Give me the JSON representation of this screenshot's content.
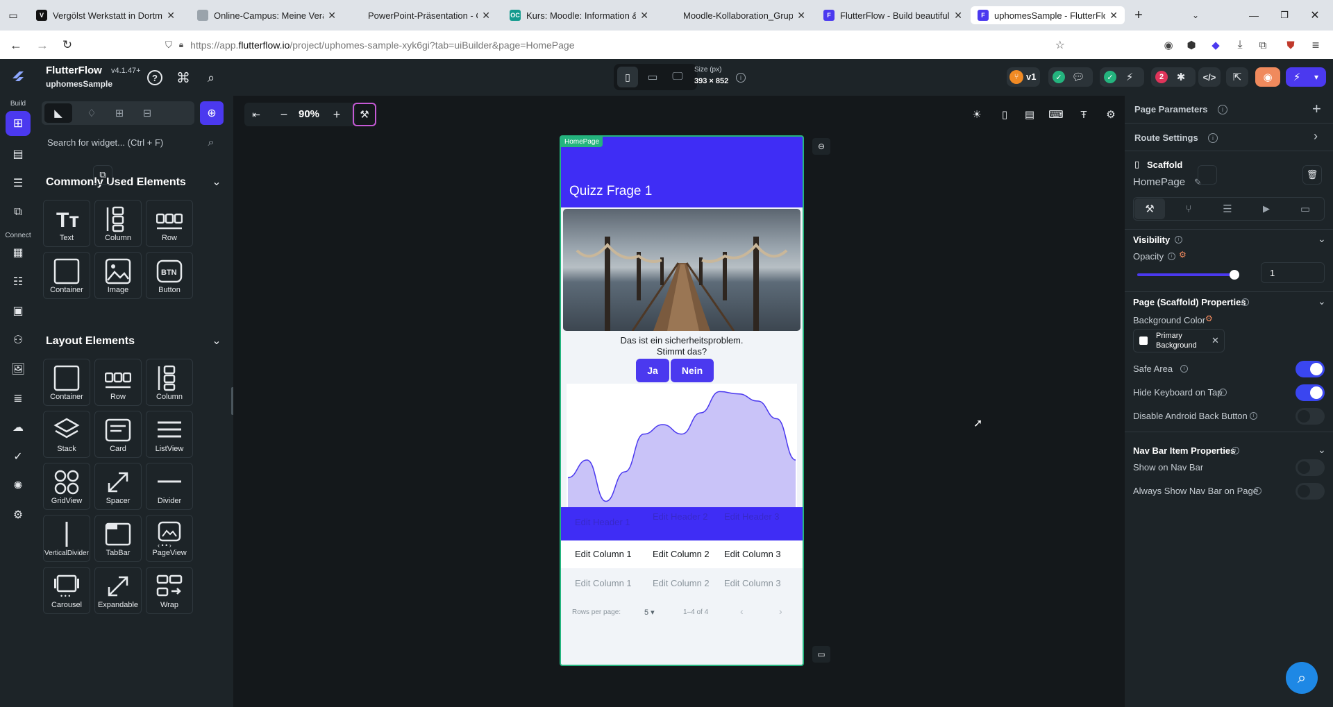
{
  "browser": {
    "tabs": [
      {
        "title": "Vergölst Werkstatt in Dortmund",
        "fav": "V",
        "color": "#111111"
      },
      {
        "title": "Online-Campus: Meine Veranst",
        "fav": "",
        "color": "#9aa3ab"
      },
      {
        "title": "PowerPoint-Präsentation - CoffeeTa",
        "fav": "",
        "color": "#dfe3e8"
      },
      {
        "title": "Kurs: Moodle: Information & Sc",
        "fav": "OC",
        "color": "#139b8e"
      },
      {
        "title": "Moodle-Kollaboration_Gruppen - M",
        "fav": "",
        "color": "#dfe3e8"
      },
      {
        "title": "FlutterFlow - Build beautiful, m",
        "fav": "F",
        "color": "#4b39ef"
      },
      {
        "title": "uphomesSample - FlutterFlow",
        "fav": "F",
        "color": "#4b39ef"
      }
    ],
    "url_prefix": "https://app.",
    "url_host": "flutterflow.io",
    "url_path": "/project/uphomes-sample-xyk6gi?tab=uiBuilder&page=HomePage"
  },
  "header": {
    "brand": "FlutterFlow",
    "version": "v4.1.47+",
    "project": "uphomesSample",
    "size_label": "Size (px)",
    "size_value": "393 × 852",
    "version_badge": "v1",
    "issues_count": "2"
  },
  "rail": {
    "build_label": "Build",
    "connect_label": "Connect"
  },
  "leftpanel": {
    "search_placeholder": "Search for widget... (Ctrl + F)",
    "common_title": "Commonly Used Elements",
    "common": [
      "Text",
      "Column",
      "Row",
      "Container",
      "Image",
      "Button"
    ],
    "layout_title": "Layout Elements",
    "layout": [
      "Container",
      "Row",
      "Column",
      "Stack",
      "Card",
      "ListView",
      "GridView",
      "Spacer",
      "Divider",
      "VerticalDivider",
      "TabBar",
      "PageView",
      "Carousel",
      "Expandable",
      "Wrap"
    ]
  },
  "canvas": {
    "zoom": "90%",
    "page_tag": "HomePage",
    "appbar_title": "Quizz Frage 1",
    "question_line1": "Das ist ein sicherheitsproblem.",
    "question_line2": "Stimmt das?",
    "btn_yes": "Ja",
    "btn_no": "Nein",
    "table_headers": [
      "Edit Header 1",
      "Edit Header 2",
      "Edit Header 3"
    ],
    "table_rows": [
      [
        "Edit Column 1",
        "Edit Column 2",
        "Edit Column 3"
      ],
      [
        "Edit Column 1",
        "Edit Column 2",
        "Edit Column 3"
      ]
    ],
    "rows_per_page_label": "Rows per page:",
    "rows_per_page": "5",
    "range": "1–4 of 4"
  },
  "rightpanel": {
    "page_parameters": "Page Parameters",
    "route_settings": "Route Settings",
    "scaffold": "Scaffold",
    "page_name": "HomePage",
    "visibility": "Visibility",
    "opacity": "Opacity",
    "opacity_value": "1",
    "opacity_level": 1,
    "scaffold_props": "Page (Scaffold) Properties",
    "bg_color_label": "Background Color",
    "bg_color_value_line1": "Primary",
    "bg_color_value_line2": "Background",
    "safe_area": "Safe Area",
    "hide_keyboard": "Hide Keyboard on Tap",
    "disable_back": "Disable Android Back Button",
    "navbar_props": "Nav Bar Item Properties",
    "show_nav": "Show on Nav Bar",
    "always_nav": "Always Show Nav Bar on Page",
    "toggles": {
      "safe_area": true,
      "hide_keyboard": true,
      "disable_back": false,
      "show_nav": false,
      "always_nav": false
    }
  },
  "colors": {
    "accent": "#4b39ef",
    "appbar": "#3f2df5",
    "chart_fill": "#c9c3f8",
    "chart_line": "#4b39ef"
  },
  "chart_data": {
    "type": "area",
    "x": [
      0,
      1,
      2,
      3,
      4,
      5,
      6,
      7,
      8,
      9,
      10,
      11,
      12
    ],
    "values": [
      25,
      40,
      5,
      30,
      62,
      70,
      62,
      80,
      98,
      96,
      90,
      75,
      40
    ],
    "ylim": [
      0,
      100
    ],
    "grid": false
  }
}
